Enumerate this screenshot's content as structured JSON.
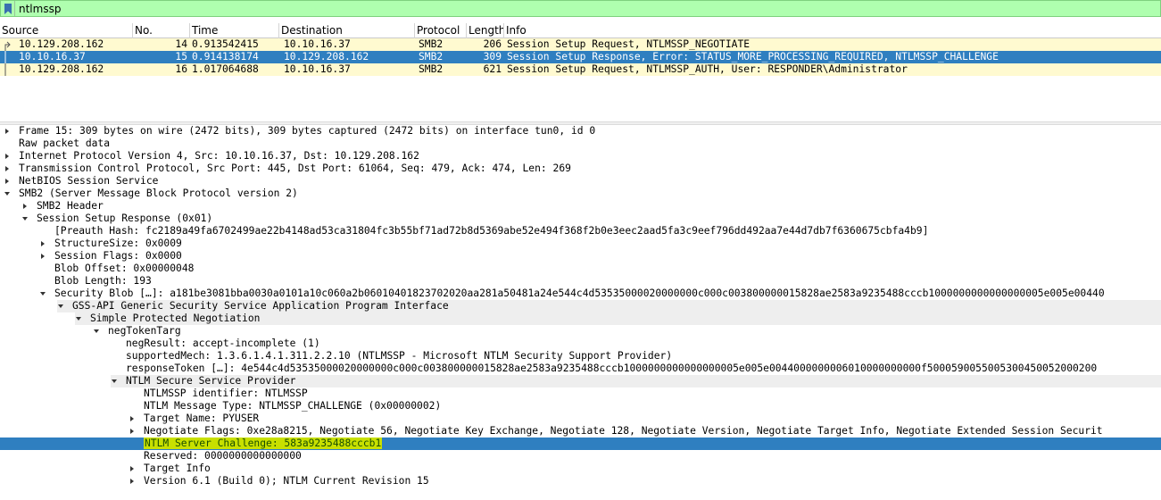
{
  "filter": {
    "value": "ntlmssp"
  },
  "packet_list": {
    "columns": [
      "Source",
      "No.",
      "Time",
      "Destination",
      "Protocol",
      "Length",
      "Info"
    ],
    "rows": [
      {
        "source": "10.129.208.162",
        "no": "14",
        "time": "0.913542415",
        "destination": "10.10.16.37",
        "protocol": "SMB2",
        "length": "206",
        "info": "Session Setup Request, NTLMSSP_NEGOTIATE",
        "selected": false
      },
      {
        "source": "10.10.16.37",
        "no": "15",
        "time": "0.914138174",
        "destination": "10.129.208.162",
        "protocol": "SMB2",
        "length": "309",
        "info": "Session Setup Response, Error: STATUS_MORE_PROCESSING_REQUIRED, NTLMSSP_CHALLENGE",
        "selected": true
      },
      {
        "source": "10.129.208.162",
        "no": "16",
        "time": "1.017064688",
        "destination": "10.10.16.37",
        "protocol": "SMB2",
        "length": "621",
        "info": "Session Setup Request, NTLMSSP_AUTH, User: RESPONDER\\Administrator",
        "selected": false
      }
    ]
  },
  "detail_tree": [
    {
      "level": 0,
      "arrow": "right",
      "text": "Frame 15: 309 bytes on wire (2472 bits), 309 bytes captured (2472 bits) on interface tun0, id 0"
    },
    {
      "level": 0,
      "arrow": "none",
      "text": "Raw packet data"
    },
    {
      "level": 0,
      "arrow": "right",
      "text": "Internet Protocol Version 4, Src: 10.10.16.37, Dst: 10.129.208.162"
    },
    {
      "level": 0,
      "arrow": "right",
      "text": "Transmission Control Protocol, Src Port: 445, Dst Port: 61064, Seq: 479, Ack: 474, Len: 269"
    },
    {
      "level": 0,
      "arrow": "right",
      "text": "NetBIOS Session Service"
    },
    {
      "level": 0,
      "arrow": "down",
      "text": "SMB2 (Server Message Block Protocol version 2)"
    },
    {
      "level": 1,
      "arrow": "right",
      "text": "SMB2 Header"
    },
    {
      "level": 1,
      "arrow": "down",
      "text": "Session Setup Response (0x01)"
    },
    {
      "level": 2,
      "arrow": "none",
      "text": "[Preauth Hash: fc2189a49fa6702499ae22b4148ad53ca31804fc3b55bf71ad72b8d5369abe52e494f368f2b0e3eec2aad5fa3c9eef796dd492aa7e44d7db7f6360675cbfa4b9]"
    },
    {
      "level": 2,
      "arrow": "right",
      "text": "StructureSize: 0x0009"
    },
    {
      "level": 2,
      "arrow": "right",
      "text": "Session Flags: 0x0000"
    },
    {
      "level": 2,
      "arrow": "none",
      "text": "Blob Offset: 0x00000048"
    },
    {
      "level": 2,
      "arrow": "none",
      "text": "Blob Length: 193"
    },
    {
      "level": 2,
      "arrow": "down",
      "text": "Security Blob […]: a181be3081bba0030a0101a10c060a2b06010401823702020aa281a50481a24e544c4d53535000020000000c000c003800000015828ae2583a9235488cccb1000000000000000005e005e00440"
    },
    {
      "level": 3,
      "arrow": "down",
      "text": "GSS-API Generic Security Service Application Program Interface",
      "shaded": true
    },
    {
      "level": 4,
      "arrow": "down",
      "text": "Simple Protected Negotiation",
      "shaded": true
    },
    {
      "level": 5,
      "arrow": "down",
      "text": "negTokenTarg"
    },
    {
      "level": 6,
      "arrow": "none",
      "text": "negResult: accept-incomplete (1)"
    },
    {
      "level": 6,
      "arrow": "none",
      "text": "supportedMech: 1.3.6.1.4.1.311.2.2.10 (NTLMSSP - Microsoft NTLM Security Support Provider)"
    },
    {
      "level": 6,
      "arrow": "none",
      "text": "responseToken […]: 4e544c4d53535000020000000c000c003800000015828ae2583a9235488cccb1000000000000000005e005e0044000000006010000000000f5000590055005300450052000200"
    },
    {
      "level": 6,
      "arrow": "down",
      "text": "NTLM Secure Service Provider",
      "shaded": true
    },
    {
      "level": 7,
      "arrow": "none",
      "text": "NTLMSSP identifier: NTLMSSP"
    },
    {
      "level": 7,
      "arrow": "none",
      "text": "NTLM Message Type: NTLMSSP_CHALLENGE (0x00000002)"
    },
    {
      "level": 7,
      "arrow": "right",
      "text": "Target Name: PYUSER"
    },
    {
      "level": 7,
      "arrow": "right",
      "text": "Negotiate Flags: 0xe28a8215, Negotiate 56, Negotiate Key Exchange, Negotiate 128, Negotiate Version, Negotiate Target Info, Negotiate Extended Session Securit"
    },
    {
      "level": 7,
      "arrow": "none",
      "text": "NTLM Server Challenge: 583a9235488cccb1",
      "selected": true
    },
    {
      "level": 7,
      "arrow": "none",
      "text": "Reserved: 0000000000000000"
    },
    {
      "level": 7,
      "arrow": "right",
      "text": "Target Info"
    },
    {
      "level": 7,
      "arrow": "right",
      "text": "Version 6.1 (Build 0); NTLM Current Revision 15"
    }
  ],
  "colors": {
    "filter_bg": "#afffaf",
    "smb_row": "#fffad0",
    "selected": "#2f7fc0",
    "highlight": "#c8e000"
  }
}
